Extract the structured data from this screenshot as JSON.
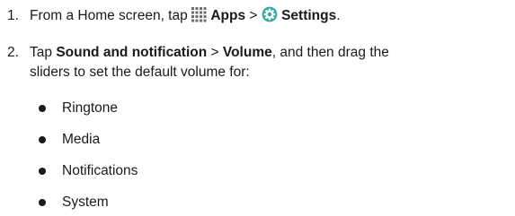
{
  "steps": [
    {
      "number": "1.",
      "prefix": "From a Home screen, tap ",
      "apps_label": "Apps",
      "separator": " > ",
      "settings_label": "Settings",
      "suffix": "."
    },
    {
      "number": "2.",
      "prefix": "Tap ",
      "sound_label": "Sound and notification",
      "separator": " > ",
      "volume_label": "Volume",
      "line1_suffix": ", and then drag the",
      "line2": "sliders to set the default volume for:"
    }
  ],
  "bullets": [
    "Ringtone",
    "Media",
    "Notifications",
    "System"
  ],
  "icons": {
    "apps": "apps-grid-icon",
    "settings": "settings-gear-icon"
  },
  "colors": {
    "text": "#1a1a1a",
    "apps_icon": "#6d6d6d",
    "settings_icon": "#2fa8a0"
  }
}
